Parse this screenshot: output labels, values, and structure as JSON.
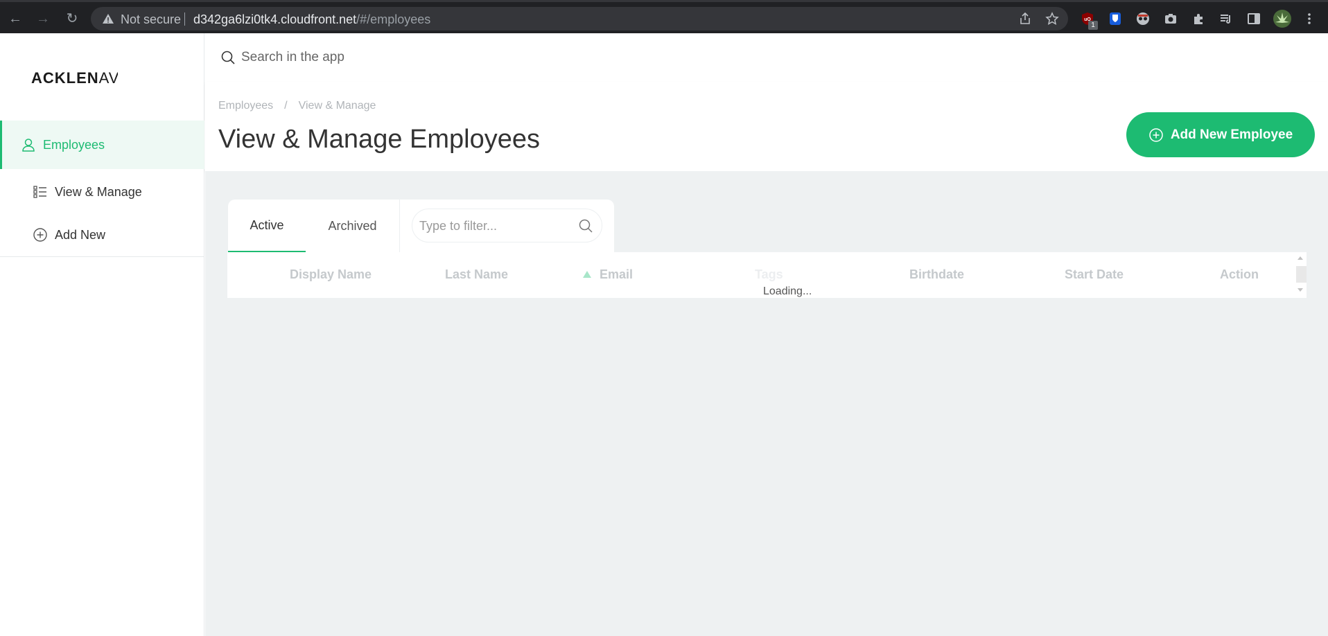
{
  "browser": {
    "security_label": "Not secure",
    "url_host": "d342ga6lzi0tk4.cloudfront.net",
    "url_path": "/#/employees",
    "extension_badge": "1"
  },
  "sidebar": {
    "logo_bold": "ACKLEN",
    "logo_light": "AV",
    "items": [
      {
        "label": "Employees",
        "icon": "user-icon",
        "active": true
      },
      {
        "label": "View & Manage",
        "icon": "list-icon",
        "active": false
      },
      {
        "label": "Add New",
        "icon": "plus-circle-icon",
        "active": false
      }
    ]
  },
  "search": {
    "placeholder": "Search in the app"
  },
  "header": {
    "breadcrumb": [
      "Employees",
      "/",
      "View & Manage"
    ],
    "title": "View & Manage Employees",
    "add_button_label": "Add New Employee"
  },
  "tabs": {
    "active_label": "Active",
    "archived_label": "Archived",
    "filter_placeholder": "Type to filter..."
  },
  "table": {
    "columns": [
      "Display Name",
      "Last Name",
      "Email",
      "Tags",
      "Birthdate",
      "Start Date",
      "Action"
    ],
    "loading_text": "Loading..."
  },
  "colors": {
    "accent": "#1dbb72",
    "chrome_bg": "#202124",
    "content_bg": "#eef1f2"
  }
}
